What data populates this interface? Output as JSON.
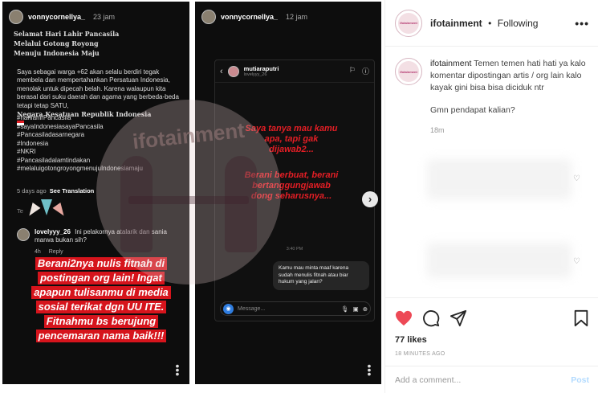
{
  "story1": {
    "username": "vonnycornellya_",
    "time": "23 jam",
    "caption_title": "Selamat Hari Lahir Pancasila\nMelalui Gotong Royong\nMenuju Indonesia Maju",
    "caption_body": "Saya sebagai warga +62 akan selalu berdiri tegak membela dan mempertahankan Persatuan Indonesia, menolak untuk dipecah belah. Karena walaupun kita berasal dari suku daerah dan agama yang berbeda-beda tetapi tetap SATU,",
    "caption_bold": "Negara Kesatuan Republik Indonesia",
    "hashtags": [
      "#harilahirPancasila",
      "#sayaIndonesiasayaPancasila",
      "#Pancasiladasarnegara",
      "#Indonesia",
      "#NKRI",
      "#Pancasiladalamtindakan",
      "#melaluigotongroyongmenujuIndonesiamaju"
    ],
    "days_ago": "5 days ago",
    "see_translation": "See Translation",
    "translation_label": "Te",
    "comment_user": "lovelyyy_26",
    "comment_text": "Ini pelakornya atalarik dan sania marwa bukan sih?",
    "comment_age": "4h",
    "comment_reply": "Reply",
    "banner_lines": [
      "Berani2nya nulis fitnah di",
      "postingan org lain! Ingat",
      "apapun tulisanmu di media",
      "sosial terikat dgn UU ITE.",
      "Fitnahmu bs berujung",
      "pencemaran nama baik!!!"
    ]
  },
  "story2": {
    "username": "vonnycornellya_",
    "time": "12 jam",
    "dm_name": "mutiaraputri",
    "dm_sub": "lovelyyy_26",
    "red1": "Saya tanya mau kamu\napa, tapi gak\ndijawab2...",
    "red2": "Berani berbuat, berani\nbertanggungjawab\ndong seharusnya...",
    "dm_time": "3:40 PM",
    "dm_message": "Kamu mau minta maaf karena sudah menulis fitnah atau biar hukum yang jalan?",
    "dm_placeholder": "Message..."
  },
  "watermark": {
    "text": "ifotainment"
  },
  "post": {
    "account": "ifotainment",
    "separator": "•",
    "follow_status": "Following",
    "logo_text": "ifotainment",
    "caption_user": "ifotainment",
    "caption": "Temen temen hati hati ya kalo komentar dipostingan artis / org lain kalo kayak gini bisa bisa diciduk ntr",
    "question": "Gmn pendapat kalian?",
    "caption_time": "18m",
    "likes": "77 likes",
    "time_ago": "18 MINUTES AGO",
    "comment_placeholder": "Add a comment...",
    "post_label": "Post"
  },
  "colors": {
    "red": "#d6141c",
    "link_blue": "#b3dbff",
    "heart": "#ed4956"
  }
}
